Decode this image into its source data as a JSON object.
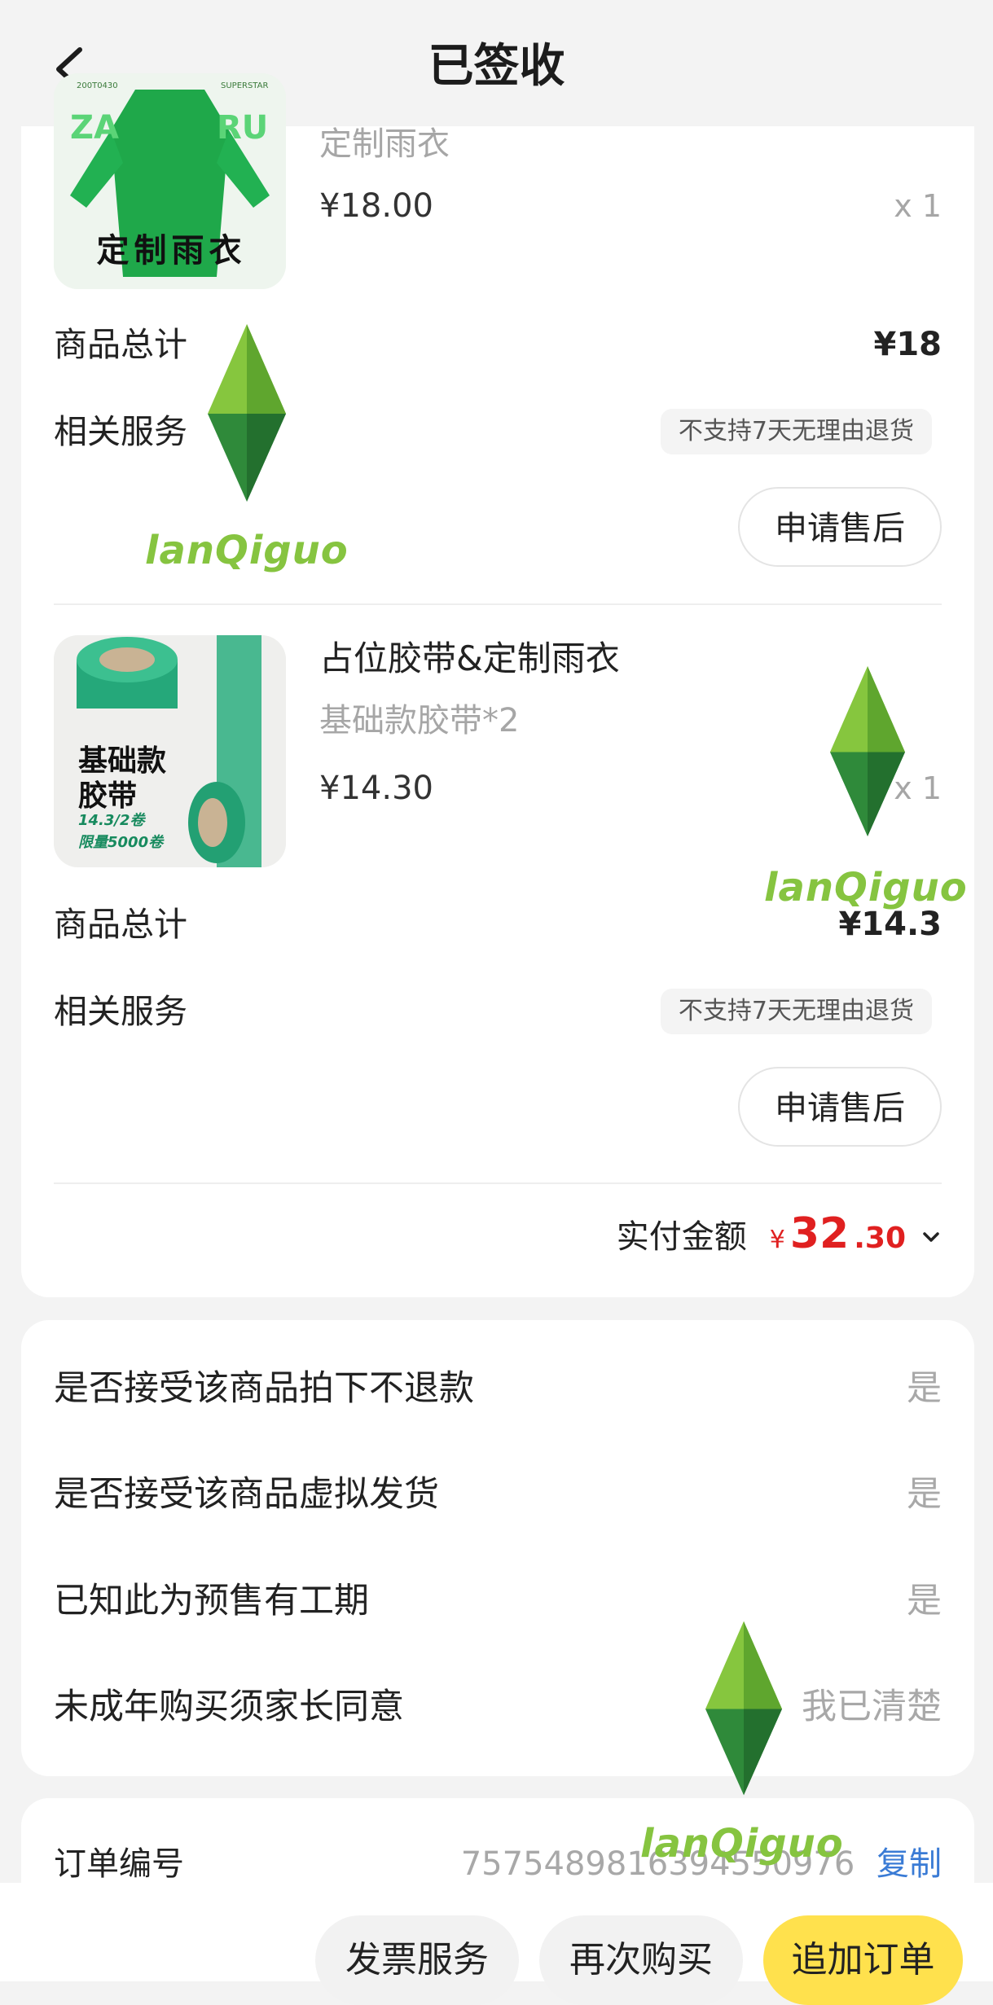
{
  "header": {
    "title": "已签收"
  },
  "items": [
    {
      "name": "",
      "spec": "定制雨衣",
      "price": "¥18.00",
      "qty": "x 1",
      "thumb_text": "定制雨衣",
      "thumb_sub_left": "200T0430",
      "thumb_sub_right": "SUPERSTAR",
      "total_label": "商品总计",
      "total_value": "¥18",
      "service_label": "相关服务",
      "service_tag": "不支持7天无理由退货",
      "aftersale_label": "申请售后"
    },
    {
      "name": "占位胶带&定制雨衣",
      "spec": "基础款胶带*2",
      "price": "¥14.30",
      "qty": "x 1",
      "thumb_text_1": "基础款",
      "thumb_text_2": "胶带",
      "thumb_text_3": "14.3/2卷",
      "thumb_text_4": "限量5000卷",
      "total_label": "商品总计",
      "total_value": "¥14.3",
      "service_label": "相关服务",
      "service_tag": "不支持7天无理由退货",
      "aftersale_label": "申请售后"
    }
  ],
  "payment": {
    "label": "实付金额",
    "currency": "¥",
    "amount_int": "32",
    "amount_dec": ".30"
  },
  "questions": [
    {
      "q": "是否接受该商品拍下不退款",
      "a": "是"
    },
    {
      "q": "是否接受该商品虚拟发货",
      "a": "是"
    },
    {
      "q": "已知此为预售有工期",
      "a": "是"
    },
    {
      "q": "未成年购买须家长同意",
      "a": "我已清楚"
    }
  ],
  "order": {
    "label": "订单编号",
    "number": "7575489816394550976",
    "copy": "复制"
  },
  "bottom_bar": {
    "invoice": "发票服务",
    "rebuy": "再次购买",
    "add_order": "追加订单"
  },
  "watermark": {
    "text": "lanQiguo"
  },
  "colors": {
    "accent_red": "#e02020",
    "accent_yellow": "#ffe14d",
    "link_blue": "#3a7bd5",
    "watermark_green": "#86c440"
  }
}
